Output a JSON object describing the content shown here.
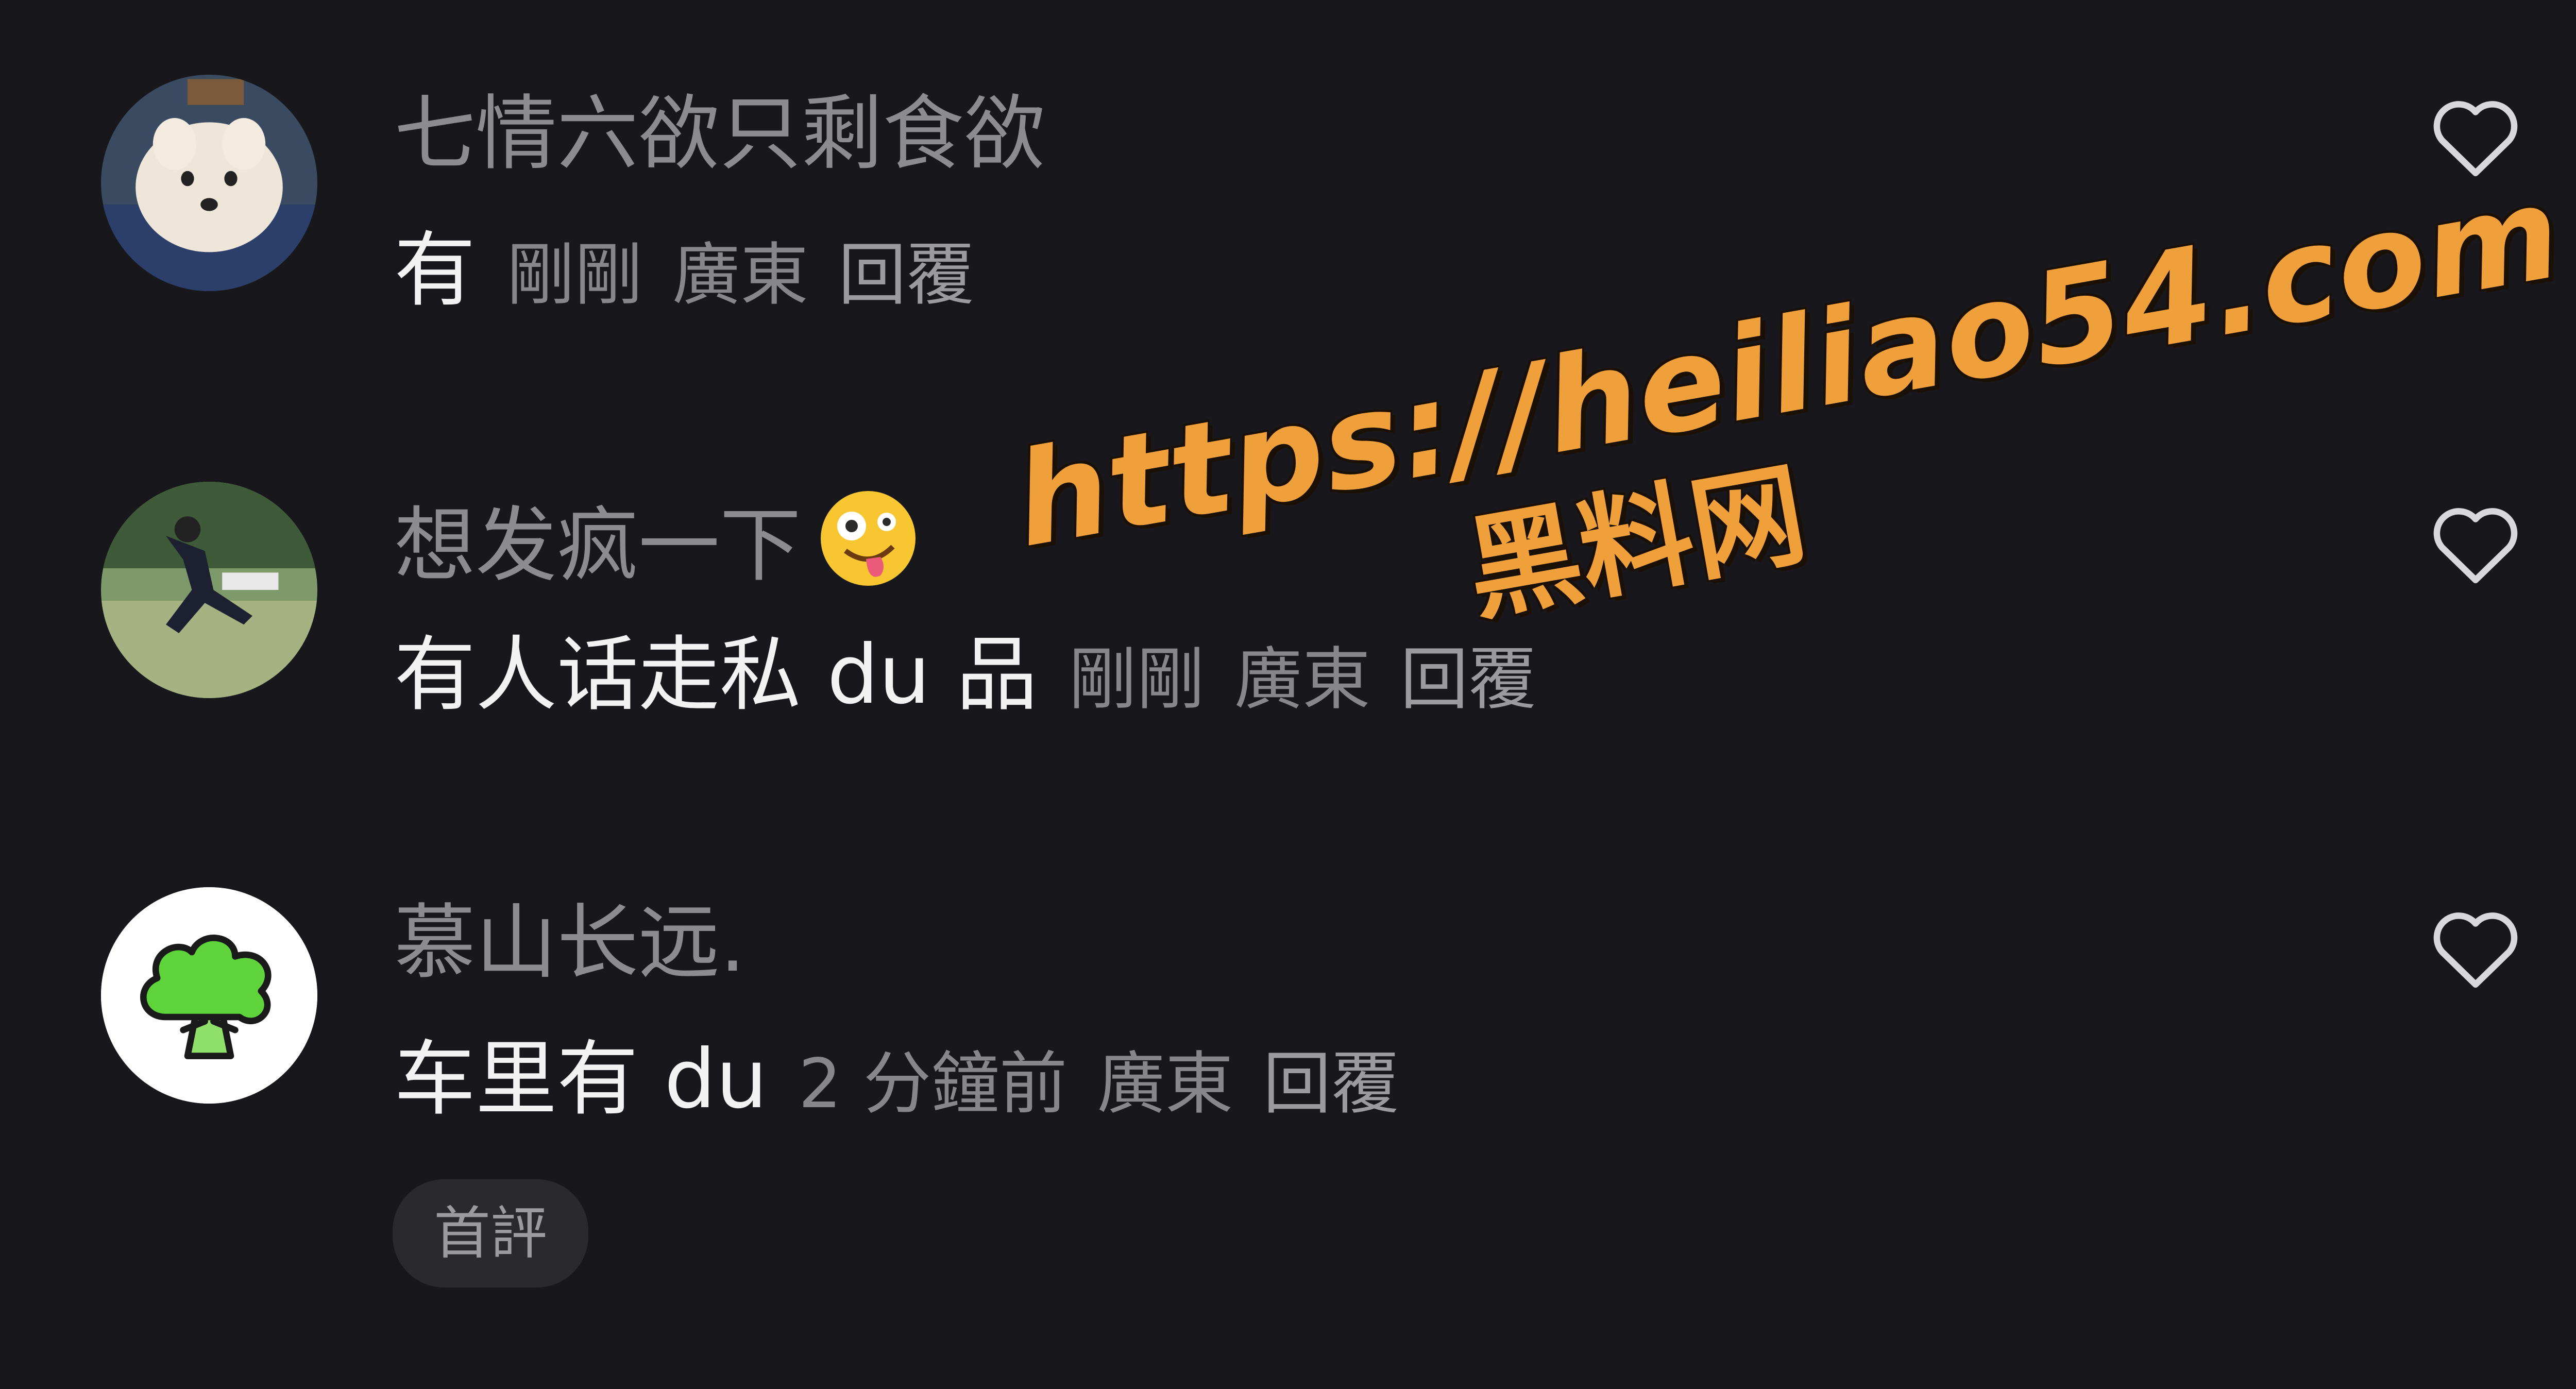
{
  "comments": [
    {
      "username": "七情六欲只剩食欲",
      "text": "有",
      "time": "剛剛",
      "location": "廣東",
      "reply_label": "回覆",
      "avatar": "samoyed-dog-avatar"
    },
    {
      "username": "想发疯一下",
      "username_emoji": "zany-face-emoji",
      "text": "有人话走私 du 品",
      "time": "剛剛",
      "location": "廣東",
      "reply_label": "回覆",
      "avatar": "person-kicking-photo-avatar"
    },
    {
      "username": "慕山长远.",
      "text": "车里有 du",
      "time": "2 分鐘前",
      "location": "廣東",
      "reply_label": "回覆",
      "avatar": "broccoli-avatar",
      "badge": "首評"
    }
  ],
  "icons": {
    "like": "heart-outline-icon"
  },
  "watermark": {
    "url": "https://heiliao54.com",
    "name": "黑料网"
  },
  "colors": {
    "background": "#18181c",
    "username": "#8b8b90",
    "text": "#f2f2f2",
    "meta": "#86868b",
    "watermark": "#f0a03a",
    "broccoli": "#5fd33a"
  }
}
